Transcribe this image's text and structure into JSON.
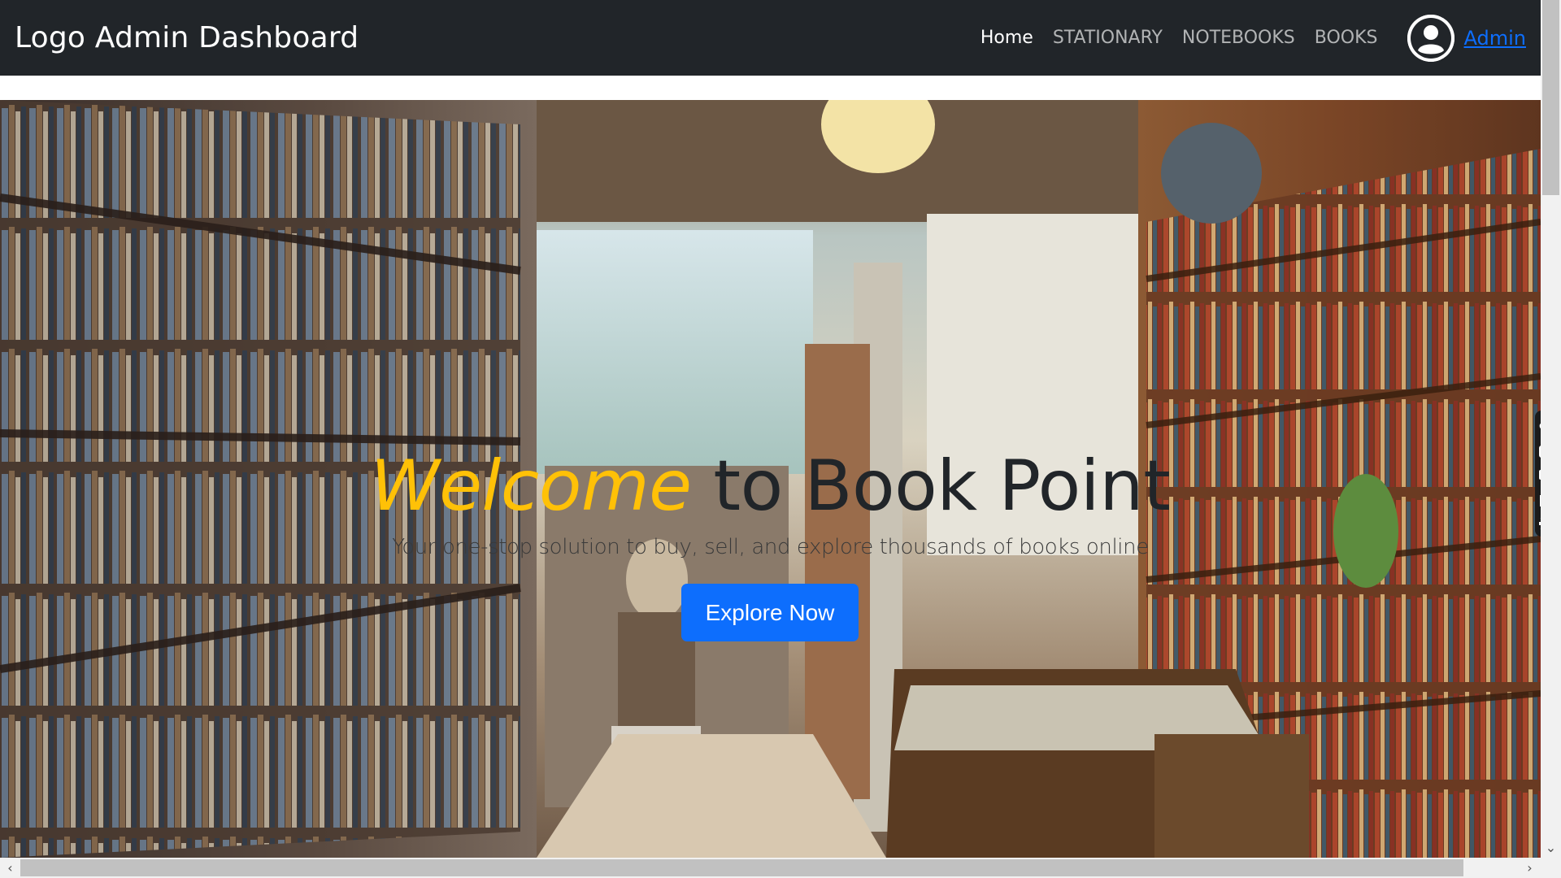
{
  "navbar": {
    "brand": "Logo Admin Dashboard",
    "links": [
      {
        "label": "Home",
        "active": true
      },
      {
        "label": "STATIONARY",
        "active": false
      },
      {
        "label": "NOTEBOOKS",
        "active": false
      },
      {
        "label": "BOOKS",
        "active": false
      }
    ],
    "avatar_icon": "user-circle-icon",
    "admin_label": "Admin"
  },
  "hero": {
    "background": "bookstore-interior-photo",
    "title_accent": "Welcome",
    "title_rest": "to Book Point",
    "subtitle": "Your one-stop solution to buy, sell, and explore thousands of books online",
    "cta_label": "Explore Now"
  },
  "side_tools": [
    "link-icon",
    "camera-icon",
    "video-icon",
    "window-icon",
    "gear-icon"
  ],
  "colors": {
    "navbar_bg": "#212529",
    "accent_yellow": "#ffc107",
    "primary_blue": "#0d6efd",
    "admin_link": "#0d6efd"
  }
}
